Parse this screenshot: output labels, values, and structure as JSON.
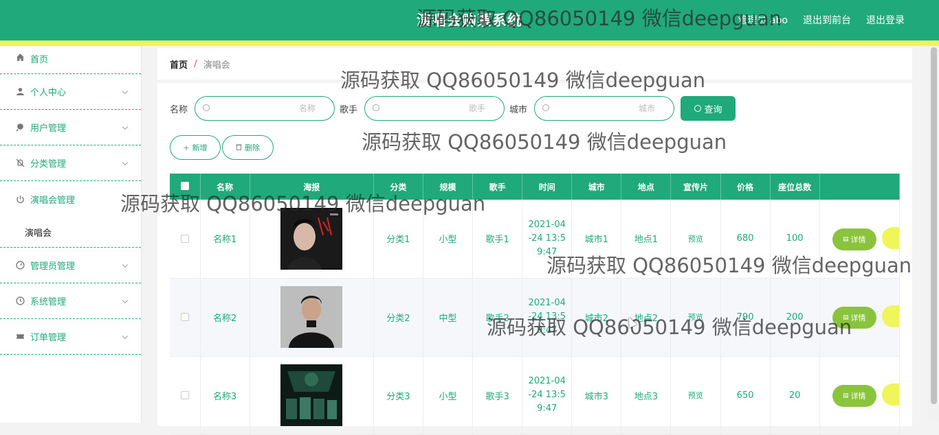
{
  "app": {
    "title": "演唱会购票系统",
    "top_links": [
      "管理员 abo",
      "退出到前台",
      "退出登录"
    ]
  },
  "sidebar": {
    "items": [
      {
        "label": "首页",
        "icon": "home-icon"
      },
      {
        "label": "个人中心",
        "icon": "user-icon"
      },
      {
        "label": "用户管理",
        "icon": "pin-icon"
      },
      {
        "label": "分类管理",
        "icon": "bell-off-icon"
      },
      {
        "label": "演唱会管理",
        "icon": "power-icon"
      },
      {
        "label": "演唱会",
        "icon": ""
      },
      {
        "label": "管理员管理",
        "icon": "gauge-icon"
      },
      {
        "label": "系统管理",
        "icon": "clock-icon"
      },
      {
        "label": "订单管理",
        "icon": "ticket-icon"
      }
    ]
  },
  "breadcrumb": {
    "home": "首页",
    "separator": "/",
    "current": "演唱会"
  },
  "search": {
    "name_label": "名称",
    "name_placeholder": "名称",
    "singer_label": "歌手",
    "singer_placeholder": "歌手",
    "city_label": "城市",
    "city_placeholder": "城市",
    "query_button": "查询"
  },
  "actions": {
    "add": "新增",
    "delete": "删除"
  },
  "table": {
    "headers": [
      "名称",
      "海报",
      "分类",
      "规模",
      "歌手",
      "时间",
      "城市",
      "地点",
      "宣传片",
      "价格",
      "座位总数"
    ],
    "detail_label": "详情",
    "rows": [
      {
        "name": "名称1",
        "category": "分类1",
        "scale": "小型",
        "singer": "歌手1",
        "time1": "2021-04",
        "time2": "-24 13:5",
        "time3": "9:47",
        "city": "城市1",
        "place": "地点1",
        "promo": "预览",
        "price": "680",
        "seats": "100"
      },
      {
        "name": "名称2",
        "category": "分类2",
        "scale": "中型",
        "singer": "歌手2",
        "time1": "2021-04",
        "time2": "-24 13:5",
        "time3": "9:47",
        "city": "城市2",
        "place": "地点2",
        "promo": "预览",
        "price": "790",
        "seats": "200"
      },
      {
        "name": "名称3",
        "category": "分类3",
        "scale": "小型",
        "singer": "歌手3",
        "time1": "2021-04",
        "time2": "-24 13:5",
        "time3": "9:47",
        "city": "城市3",
        "place": "地点3",
        "promo": "预览",
        "price": "650",
        "seats": "20"
      }
    ]
  },
  "watermark": "源码获取 QQ86050149 微信deepguan",
  "colors": {
    "primary": "#20a97a",
    "accent_yellow": "#eef55a",
    "detail_button": "#8ac43c"
  }
}
